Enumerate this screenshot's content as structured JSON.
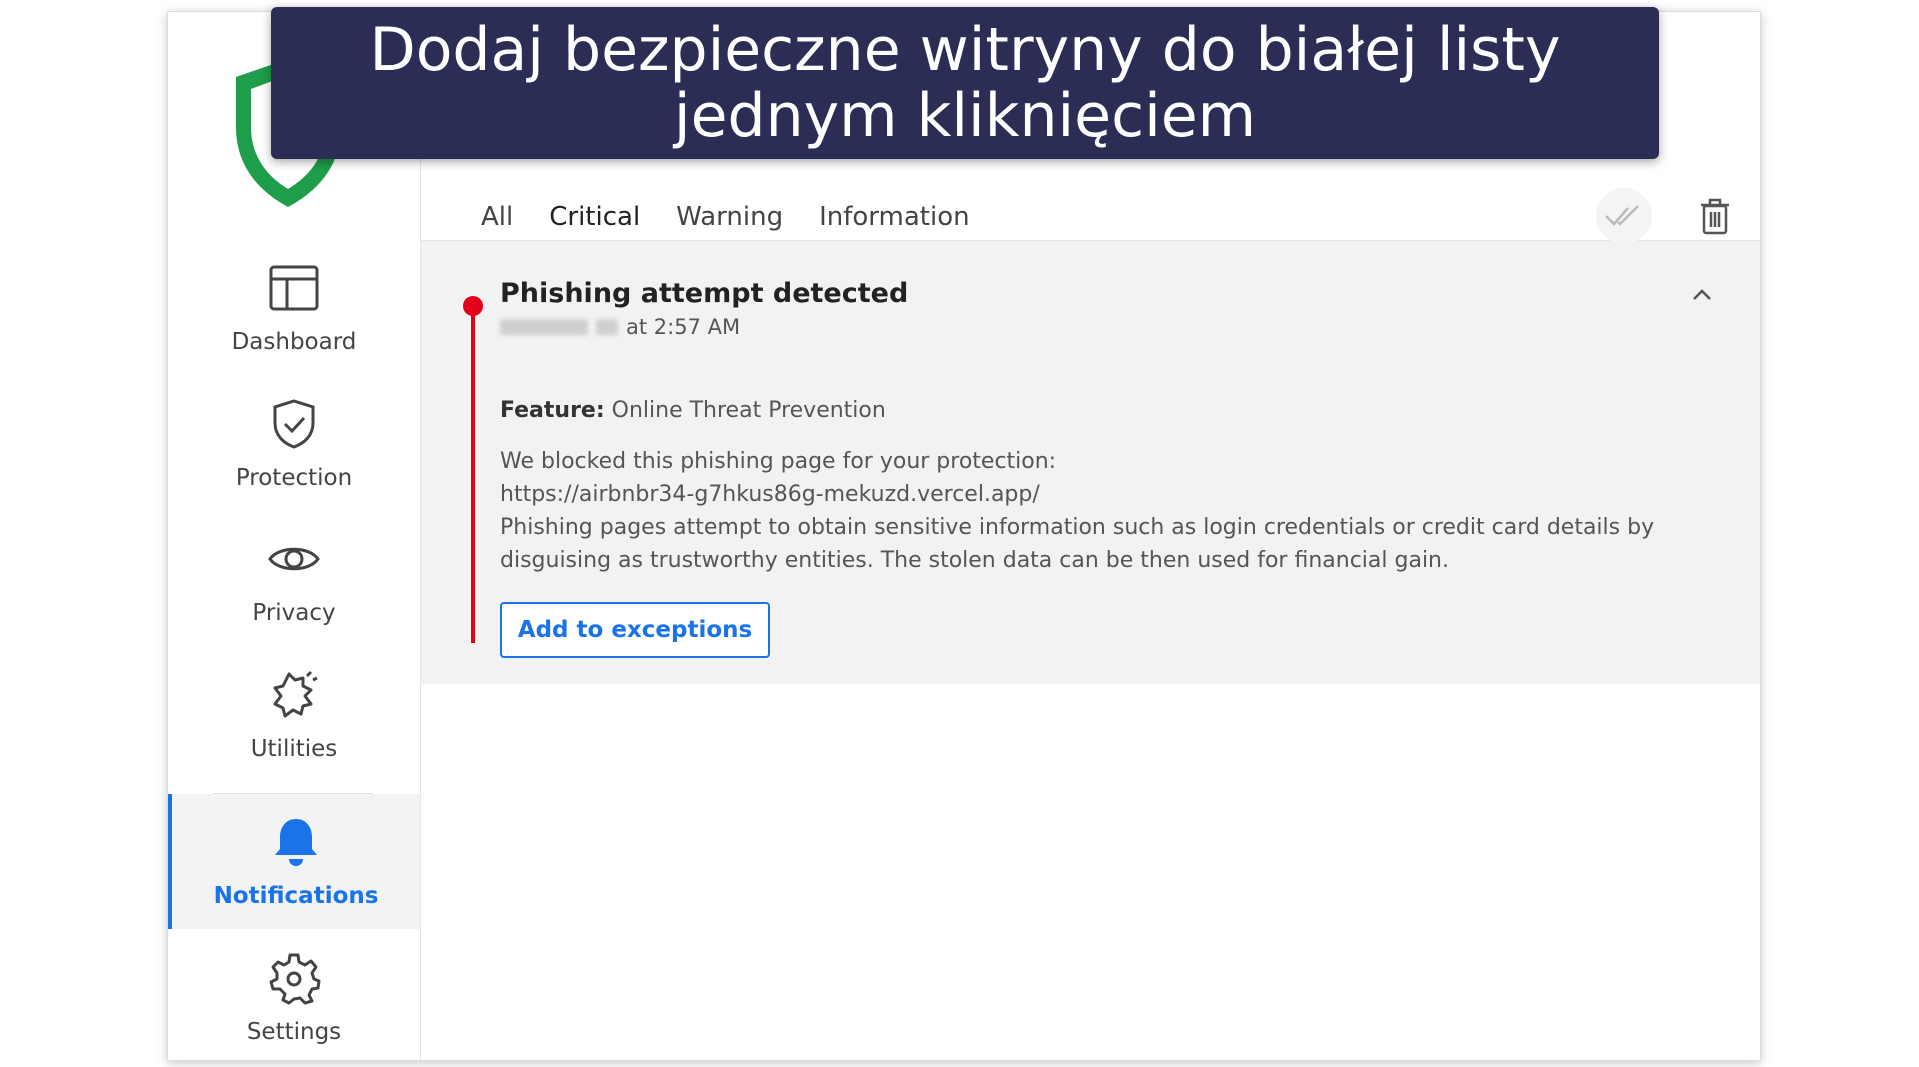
{
  "banner": {
    "line1": "Dodaj bezpieczne witryny do białej listy",
    "line2": "jednym kliknięciem"
  },
  "sidebar": {
    "items": [
      {
        "label": "Dashboard",
        "icon": "dashboard-icon"
      },
      {
        "label": "Protection",
        "icon": "shield-check-icon"
      },
      {
        "label": "Privacy",
        "icon": "eye-icon"
      },
      {
        "label": "Utilities",
        "icon": "utilities-icon"
      },
      {
        "label": "Notifications",
        "icon": "bell-icon",
        "active": true
      },
      {
        "label": "Settings",
        "icon": "gear-icon"
      }
    ]
  },
  "tabs": [
    {
      "label": "All"
    },
    {
      "label": "Critical",
      "active": true
    },
    {
      "label": "Warning"
    },
    {
      "label": "Information"
    }
  ],
  "notification": {
    "title": "Phishing attempt detected",
    "date_suffix": "at 2:57 AM",
    "feature_label": "Feature:",
    "feature_value": "Online Threat Prevention",
    "body_line1": "We blocked this phishing page for your protection:",
    "body_line2": "https://airbnbr34-g7hkus86g-mekuzd.vercel.app/",
    "body_line3": "Phishing pages attempt to obtain sensitive information such as login credentials or credit card details by",
    "body_line4": "disguising as trustworthy entities. The stolen data can be then used for financial gain.",
    "action_label": "Add to exceptions"
  },
  "colors": {
    "accent": "#1a73e8",
    "critical": "#e2001a",
    "banner_bg": "#2b2d55",
    "shield_green": "#1e9e4a"
  }
}
